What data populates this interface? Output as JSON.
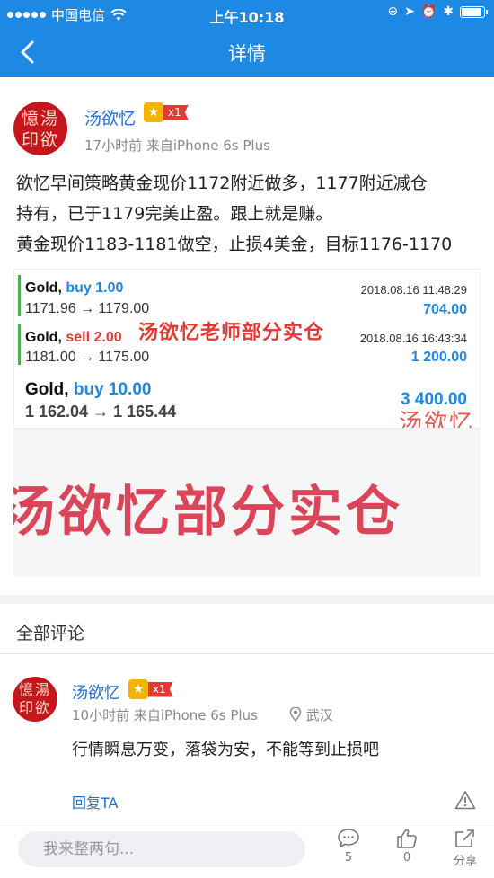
{
  "status_bar": {
    "carrier": "中国电信",
    "time": "上午10:18"
  },
  "nav": {
    "title": "详情"
  },
  "post": {
    "avatar_text": [
      "憶湯",
      "印欲"
    ],
    "username": "汤欲忆",
    "badge_count": "x1",
    "meta": "17小时前  来自iPhone 6s Plus",
    "text_lines": [
      "欲忆早间策略黄金现价1172附近做多，1177附近减仓",
      "持有，已于1179完美止盈。跟上就是赚。",
      "黄金现价1183-1181做空，止损4美金，目标1176-1170"
    ],
    "trades": [
      {
        "symbol": "Gold,",
        "side": "buy 1.00",
        "prices": "1171.96 → 1179.00",
        "date": "2018.08.16 11:48:29",
        "profit": "704.00"
      },
      {
        "symbol": "Gold,",
        "side": "sell 2.00",
        "prices": "1181.00 → 1175.00",
        "date": "2018.08.16 16:43:34",
        "profit": "1 200.00"
      },
      {
        "symbol": "Gold,",
        "side": "buy 10.00",
        "prices": "1 162.04 → 1 165.44",
        "date": "",
        "profit": "3 400.00"
      }
    ],
    "overlay_text": "汤欲忆老师部分实仓",
    "signature_text": "汤欲忆",
    "banner_text": "汤欲忆部分实仓"
  },
  "comments": {
    "title": "全部评论",
    "items": [
      {
        "avatar_text": [
          "憶湯",
          "印欲"
        ],
        "username": "汤欲忆",
        "badge_count": "x1",
        "meta": "10小时前  来自iPhone 6s Plus",
        "location": "武汉",
        "text": "行情瞬息万变，落袋为安，不能等到止损吧",
        "reply_label": "回复TA"
      }
    ]
  },
  "bottom_bar": {
    "input_placeholder": "我来整两句...",
    "comment_count": "5",
    "like_count": "0",
    "share_label": "分享"
  },
  "colors": {
    "brand_blue": "#1e88e5",
    "link_blue": "#1e6fd9",
    "accent_red": "#e53935"
  }
}
